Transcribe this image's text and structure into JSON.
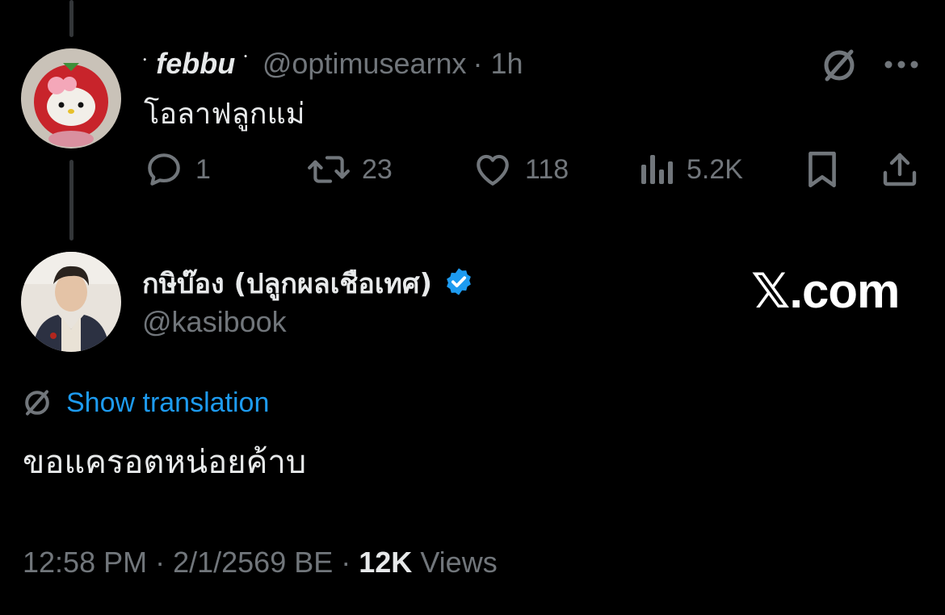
{
  "parent_tweet": {
    "display_name": "febbu",
    "name_decoration_left": "ॱ",
    "name_decoration_right": "ᣟ",
    "handle": "@optimusearnx",
    "time": "· 1h",
    "text": "โอลาฟลูกแม่",
    "actions": {
      "reply_count": "1",
      "retweet_count": "23",
      "like_count": "118",
      "views_count": "5.2K"
    },
    "icons": [
      "reply-icon",
      "retweet-icon",
      "like-icon",
      "views-icon",
      "bookmark-icon",
      "share-icon",
      "translate-icon",
      "more-icon"
    ]
  },
  "main_tweet": {
    "display_name": "กษิบ๊อง (ปลูกผลเชือเทศ)",
    "handle": "@kasibook",
    "verified": true,
    "translate_label": "Show translation",
    "text": "ขอแครอตหน่อยค้าบ",
    "timestamp": "12:58 PM · 2/1/2569 BE ·",
    "views_number": "12K",
    "views_label": "Views"
  },
  "watermark": "𝕏.com",
  "colors": {
    "background": "#000000",
    "text": "#e7e9ea",
    "muted": "#71767b",
    "link": "#1d9bf0",
    "verified": "#1d9bf0",
    "thread_line": "#333639"
  }
}
